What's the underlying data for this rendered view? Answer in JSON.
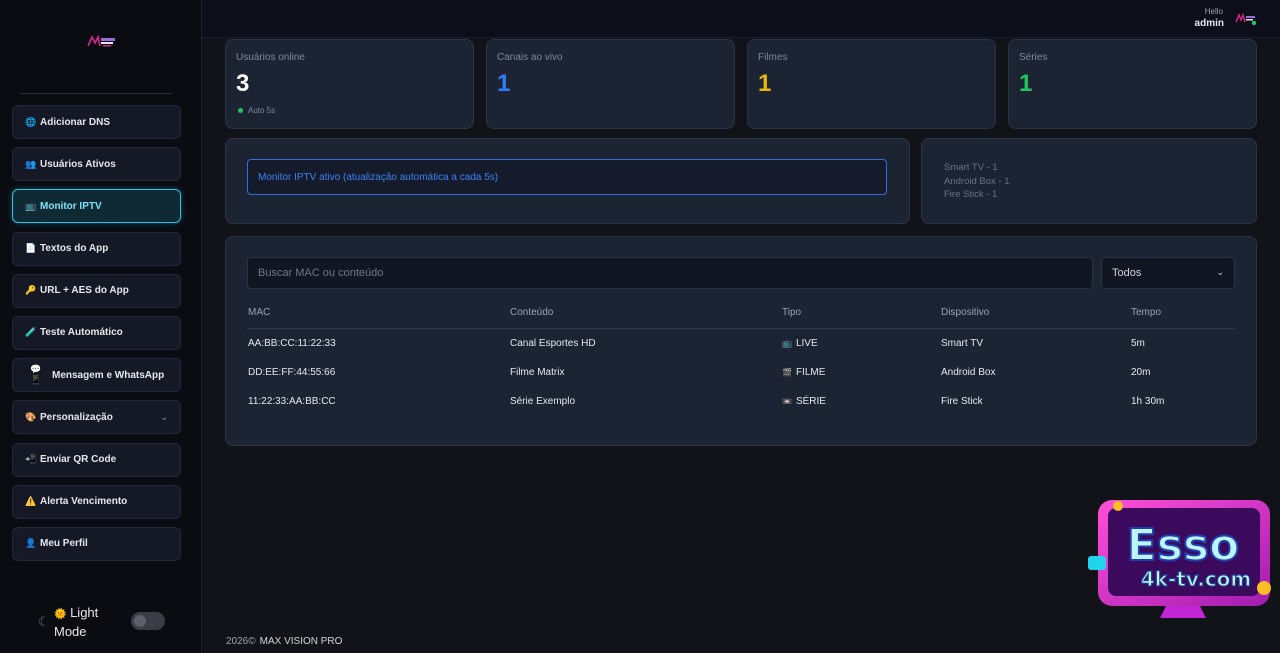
{
  "sidebar": {
    "items": [
      {
        "icon": "🌐",
        "icon_name": "globe-icon",
        "label": "Adicionar DNS"
      },
      {
        "icon": "👥",
        "icon_name": "users-icon",
        "label": "Usuários Ativos"
      },
      {
        "icon": "📺",
        "icon_name": "tv-icon",
        "label": "Monitor IPTV",
        "active": true
      },
      {
        "icon": "📄",
        "icon_name": "document-icon",
        "label": "Textos do App"
      },
      {
        "icon": "🔑",
        "icon_name": "key-icon",
        "label": "URL + AES do App"
      },
      {
        "icon": "🧪",
        "icon_name": "test-icon",
        "label": "Teste Automático"
      },
      {
        "icon": "💬📱",
        "icon_name": "message-phone-icon",
        "label": "Mensagem e WhatsApp"
      },
      {
        "icon": "🎨",
        "icon_name": "palette-icon",
        "label": "Personalização",
        "has_submenu": true
      },
      {
        "icon": "📲",
        "icon_name": "qr-send-icon",
        "label": "Enviar QR Code"
      },
      {
        "icon": "⚠️",
        "icon_name": "warning-icon",
        "label": "Alerta Vencimento"
      },
      {
        "icon": "👤",
        "icon_name": "profile-icon",
        "label": "Meu Perfil"
      }
    ],
    "theme_toggle": {
      "icon": "🌞",
      "label": "Light Mode",
      "enabled": false
    }
  },
  "header": {
    "greeting": "Hello",
    "username": "admin"
  },
  "stats": [
    {
      "label": "Usuários online",
      "value": "3",
      "color": "#ffffff"
    },
    {
      "label": "Canais ao vivo",
      "value": "1",
      "color": "#2d7ff9"
    },
    {
      "label": "Filmes",
      "value": "1",
      "color": "#eab308"
    },
    {
      "label": "Séries",
      "value": "1",
      "color": "#22c55e"
    }
  ],
  "auto_refresh": "Auto 5s",
  "monitor_alert": "Monitor IPTV ativo (atualização automática a cada 5s)",
  "devices": [
    "Smart TV - 1",
    "Android Box - 1",
    "Fire Stick - 1"
  ],
  "search": {
    "placeholder": "Buscar MAC ou conteúdo",
    "value": ""
  },
  "filter": {
    "selected": "Todos"
  },
  "table": {
    "columns": [
      "MAC",
      "Conteúdo",
      "Tipo",
      "Dispositivo",
      "Tempo"
    ],
    "rows": [
      {
        "mac": "AA:BB:CC:11:22:33",
        "content": "Canal Esportes HD",
        "type_icon": "📺",
        "type": "LIVE",
        "device": "Smart TV",
        "time": "5m"
      },
      {
        "mac": "DD:EE:FF:44:55:66",
        "content": "Filme Matrix",
        "type_icon": "🎬",
        "type": "FILME",
        "device": "Android Box",
        "time": "20m"
      },
      {
        "mac": "11:22:33:AA:BB:CC",
        "content": "Série Exemplo",
        "type_icon": "📼",
        "type": "SÉRIE",
        "device": "Fire Stick",
        "time": "1h 30m"
      }
    ]
  },
  "footer": {
    "year": "2026©",
    "brand": "MAX VISION PRO"
  },
  "colors": {
    "accent": "#22c3e6",
    "card_bg": "#1c2434",
    "page_bg": "#111318",
    "sidebar_bg": "#0a0c12"
  }
}
